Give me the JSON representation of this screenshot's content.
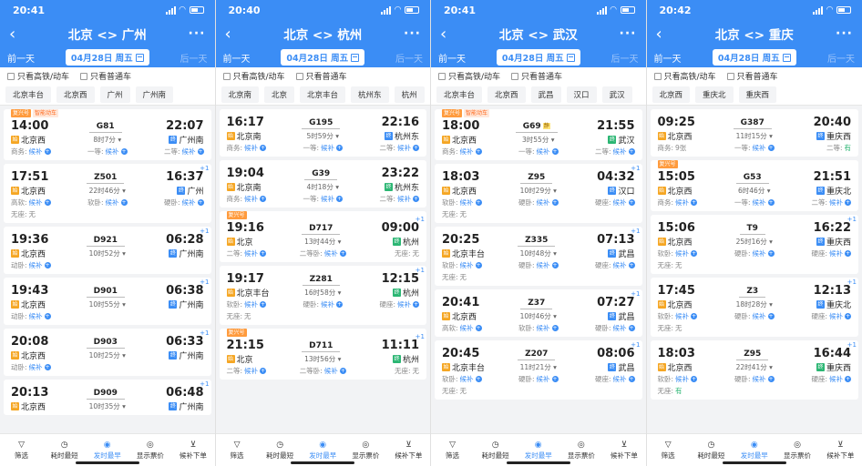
{
  "screens": [
    {
      "time": "20:41",
      "title": "北京 <> 广州",
      "prev": "前一天",
      "next": "后一天",
      "date": "04月28日 周五",
      "filters": [
        "只看高铁/动车",
        "只看普通车"
      ],
      "stations": [
        "北京丰台",
        "北京西",
        "广州",
        "广州南"
      ],
      "trains": [
        {
          "tags": [
            "复兴号",
            "智能动车"
          ],
          "dep": "14:00",
          "arr": "22:07",
          "no": "G81",
          "dur": "8时7分",
          "from": "北京西",
          "to": "广州南",
          "fb": "bo",
          "tb": "bb",
          "plus": "",
          "seats": [
            [
              "商务:",
              "候补",
              "hb"
            ],
            [
              "一等:",
              "候补",
              "hb"
            ],
            [
              "二等:",
              "候补",
              "hb"
            ]
          ]
        },
        {
          "tags": [],
          "dep": "17:51",
          "arr": "16:37",
          "no": "Z501",
          "dur": "22时46分",
          "from": "北京西",
          "to": "广州",
          "fb": "bo",
          "tb": "bb",
          "plus": "+1",
          "seats": [
            [
              "高软:",
              "候补",
              "hb"
            ],
            [
              "软卧:",
              "候补",
              "hb"
            ],
            [
              "硬卧:",
              "候补",
              "hb"
            ],
            [
              "无座:",
              "无",
              ""
            ]
          ]
        },
        {
          "tags": [],
          "dep": "19:36",
          "arr": "06:28",
          "no": "D921",
          "dur": "10时52分",
          "from": "北京西",
          "to": "广州南",
          "fb": "bo",
          "tb": "bb",
          "plus": "+1",
          "seats": [
            [
              "动卧:",
              "候补",
              "hb"
            ]
          ]
        },
        {
          "tags": [],
          "dep": "19:43",
          "arr": "06:38",
          "no": "D901",
          "dur": "10时55分",
          "from": "北京西",
          "to": "广州南",
          "fb": "bo",
          "tb": "bb",
          "plus": "+1",
          "seats": [
            [
              "动卧:",
              "候补",
              "hb"
            ]
          ]
        },
        {
          "tags": [],
          "dep": "20:08",
          "arr": "06:33",
          "no": "D903",
          "dur": "10时25分",
          "from": "北京西",
          "to": "广州南",
          "fb": "bo",
          "tb": "bb",
          "plus": "+1",
          "seats": [
            [
              "动卧:",
              "候补",
              "hb"
            ]
          ]
        },
        {
          "tags": [],
          "dep": "20:13",
          "arr": "06:48",
          "no": "D909",
          "dur": "10时35分",
          "from": "北京西",
          "to": "广州南",
          "fb": "bo",
          "tb": "bb",
          "plus": "+1",
          "seats": []
        }
      ]
    },
    {
      "time": "20:40",
      "title": "北京 <> 杭州",
      "prev": "前一天",
      "next": "后一天",
      "date": "04月28日 周五",
      "filters": [
        "只看高铁/动车",
        "只看普通车"
      ],
      "stations": [
        "北京南",
        "北京",
        "北京丰台",
        "杭州东",
        "杭州"
      ],
      "trains": [
        {
          "tags": [],
          "dep": "16:17",
          "arr": "22:16",
          "no": "G195",
          "dur": "5时59分",
          "from": "北京南",
          "to": "杭州东",
          "fb": "bo",
          "tb": "bb",
          "plus": "",
          "seats": [
            [
              "商务:",
              "候补",
              "hb"
            ],
            [
              "一等:",
              "候补",
              "hb"
            ],
            [
              "二等:",
              "候补",
              "hb"
            ]
          ]
        },
        {
          "tags": [],
          "dep": "19:04",
          "arr": "23:22",
          "no": "G39",
          "dur": "4时18分",
          "from": "北京南",
          "to": "杭州东",
          "fb": "bo",
          "tb": "bg",
          "plus": "",
          "seats": [
            [
              "商务:",
              "候补",
              "hb"
            ],
            [
              "一等:",
              "候补",
              "hb"
            ],
            [
              "二等:",
              "候补",
              "hb"
            ]
          ]
        },
        {
          "tags": [
            "复兴号"
          ],
          "dep": "19:16",
          "arr": "09:00",
          "no": "D717",
          "dur": "13时44分",
          "from": "北京",
          "to": "杭州",
          "fb": "bo",
          "tb": "bg",
          "plus": "+1",
          "seats": [
            [
              "二等:",
              "候补",
              "hb"
            ],
            [
              "二等卧:",
              "候补",
              "hb"
            ],
            [
              "无座:",
              "无",
              ""
            ]
          ]
        },
        {
          "tags": [],
          "dep": "19:17",
          "arr": "12:15",
          "no": "Z281",
          "dur": "16时58分",
          "from": "北京丰台",
          "to": "杭州",
          "fb": "bo",
          "tb": "bg",
          "plus": "+1",
          "seats": [
            [
              "软卧:",
              "候补",
              "hb"
            ],
            [
              "硬卧:",
              "候补",
              "hb"
            ],
            [
              "硬座:",
              "候补",
              "hb"
            ],
            [
              "无座:",
              "无",
              ""
            ]
          ]
        },
        {
          "tags": [
            "复兴号"
          ],
          "dep": "21:15",
          "arr": "11:11",
          "no": "D711",
          "dur": "13时56分",
          "from": "北京",
          "to": "杭州",
          "fb": "bo",
          "tb": "bg",
          "plus": "+1",
          "seats": [
            [
              "二等:",
              "候补",
              "hb"
            ],
            [
              "二等卧:",
              "候补",
              "hb"
            ],
            [
              "无座:",
              "无",
              ""
            ]
          ]
        }
      ]
    },
    {
      "time": "20:41",
      "title": "北京 <> 武汉",
      "prev": "前一天",
      "next": "后一天",
      "date": "04月28日 周五",
      "filters": [
        "只看高铁/动车",
        "只看普通车"
      ],
      "stations": [
        "北京丰台",
        "北京西",
        "武昌",
        "汉口",
        "武汉"
      ],
      "trains": [
        {
          "tags": [
            "复兴号",
            "智能动车"
          ],
          "dep": "18:00",
          "arr": "21:55",
          "no": "G69",
          "jing": "静",
          "dur": "3时55分",
          "from": "北京西",
          "to": "武汉",
          "fb": "bo",
          "tb": "bg",
          "plus": "",
          "seats": [
            [
              "商务:",
              "候补",
              "hb"
            ],
            [
              "一等:",
              "候补",
              "hb"
            ],
            [
              "二等:",
              "候补",
              "hb"
            ]
          ]
        },
        {
          "tags": [],
          "dep": "18:03",
          "arr": "04:32",
          "no": "Z95",
          "dur": "10时29分",
          "from": "北京西",
          "to": "汉口",
          "fb": "bo",
          "tb": "bb",
          "plus": "+1",
          "seats": [
            [
              "软卧:",
              "候补",
              "hb"
            ],
            [
              "硬卧:",
              "候补",
              "hb"
            ],
            [
              "硬座:",
              "候补",
              "hb"
            ],
            [
              "无座:",
              "无",
              ""
            ]
          ]
        },
        {
          "tags": [],
          "dep": "20:25",
          "arr": "07:13",
          "no": "Z335",
          "dur": "10时48分",
          "from": "北京丰台",
          "to": "武昌",
          "fb": "bo",
          "tb": "bb",
          "plus": "+1",
          "seats": [
            [
              "软卧:",
              "候补",
              "hb"
            ],
            [
              "硬卧:",
              "候补",
              "hb"
            ],
            [
              "硬座:",
              "候补",
              "hb"
            ],
            [
              "无座:",
              "无",
              ""
            ]
          ]
        },
        {
          "tags": [],
          "dep": "20:41",
          "arr": "07:27",
          "no": "Z37",
          "dur": "10时46分",
          "from": "北京西",
          "to": "武昌",
          "fb": "bo",
          "tb": "bb",
          "plus": "+1",
          "seats": [
            [
              "高软:",
              "候补",
              "hb"
            ],
            [
              "软卧:",
              "候补",
              "hb"
            ],
            [
              "硬卧:",
              "候补",
              "hb"
            ]
          ]
        },
        {
          "tags": [],
          "dep": "20:45",
          "arr": "08:06",
          "no": "Z207",
          "dur": "11时21分",
          "from": "北京丰台",
          "to": "武昌",
          "fb": "bo",
          "tb": "bb",
          "plus": "+1",
          "seats": [
            [
              "软卧:",
              "候补",
              "hb"
            ],
            [
              "硬卧:",
              "候补",
              "hb"
            ],
            [
              "硬座:",
              "候补",
              "hb"
            ],
            [
              "无座:",
              "无",
              ""
            ]
          ]
        }
      ]
    },
    {
      "time": "20:42",
      "title": "北京 <> 重庆",
      "prev": "前一天",
      "next": "后一天",
      "date": "04月28日 周五",
      "filters": [
        "只看高铁/动车",
        "只看普通车"
      ],
      "stations": [
        "北京西",
        "重庆北",
        "重庆西"
      ],
      "trains": [
        {
          "tags": [],
          "dep": "09:25",
          "arr": "20:40",
          "no": "G387",
          "dur": "11时15分",
          "from": "北京西",
          "to": "重庆西",
          "fb": "bo",
          "tb": "bb",
          "plus": "",
          "seats": [
            [
              "商务:",
              "9张",
              ""
            ],
            [
              "一等:",
              "候补",
              "hb"
            ],
            [
              "二等:",
              "有",
              "ok"
            ]
          ]
        },
        {
          "tags": [
            "复兴号"
          ],
          "dep": "15:05",
          "arr": "21:51",
          "no": "G53",
          "dur": "6时46分",
          "from": "北京西",
          "to": "重庆北",
          "fb": "bo",
          "tb": "bb",
          "plus": "",
          "seats": [
            [
              "商务:",
              "候补",
              "hb"
            ],
            [
              "一等:",
              "候补",
              "hb"
            ],
            [
              "二等:",
              "候补",
              "hb"
            ]
          ]
        },
        {
          "tags": [],
          "dep": "15:06",
          "arr": "16:22",
          "no": "T9",
          "dur": "25时16分",
          "from": "北京西",
          "to": "重庆西",
          "fb": "bo",
          "tb": "bb",
          "plus": "+1",
          "seats": [
            [
              "软卧:",
              "候补",
              "hb"
            ],
            [
              "硬卧:",
              "候补",
              "hb"
            ],
            [
              "硬座:",
              "候补",
              "hb"
            ],
            [
              "无座:",
              "无",
              ""
            ]
          ]
        },
        {
          "tags": [],
          "dep": "17:45",
          "arr": "12:13",
          "no": "Z3",
          "dur": "18时28分",
          "from": "北京西",
          "to": "重庆北",
          "fb": "bo",
          "tb": "bb",
          "plus": "+1",
          "seats": [
            [
              "软卧:",
              "候补",
              "hb"
            ],
            [
              "硬卧:",
              "候补",
              "hb"
            ],
            [
              "硬座:",
              "候补",
              "hb"
            ],
            [
              "无座:",
              "无",
              ""
            ]
          ]
        },
        {
          "tags": [],
          "dep": "18:03",
          "arr": "16:44",
          "no": "Z95",
          "dur": "22时41分",
          "from": "北京西",
          "to": "重庆西",
          "fb": "bo",
          "tb": "bg",
          "plus": "+1",
          "seats": [
            [
              "软卧:",
              "候补",
              "hb"
            ],
            [
              "硬卧:",
              "候补",
              "hb"
            ],
            [
              "硬座:",
              "候补",
              "hb"
            ],
            [
              "无座:",
              "有",
              "ok"
            ]
          ]
        }
      ]
    }
  ],
  "tabs": [
    {
      "label": "筛选",
      "icon": "filter-icon",
      "glyph": "▽",
      "active": false
    },
    {
      "label": "耗时最短",
      "icon": "clock-icon",
      "glyph": "◷",
      "active": false
    },
    {
      "label": "发时最早",
      "icon": "early-icon",
      "glyph": "◉",
      "active": true
    },
    {
      "label": "显示票价",
      "icon": "price-icon",
      "glyph": "◎",
      "active": false
    },
    {
      "label": "候补下单",
      "icon": "cart-icon",
      "glyph": "⊻",
      "active": false
    }
  ],
  "colors": {
    "primary": "#3b8df5",
    "available": "#2bb673",
    "tag": "#ff9b3d"
  }
}
